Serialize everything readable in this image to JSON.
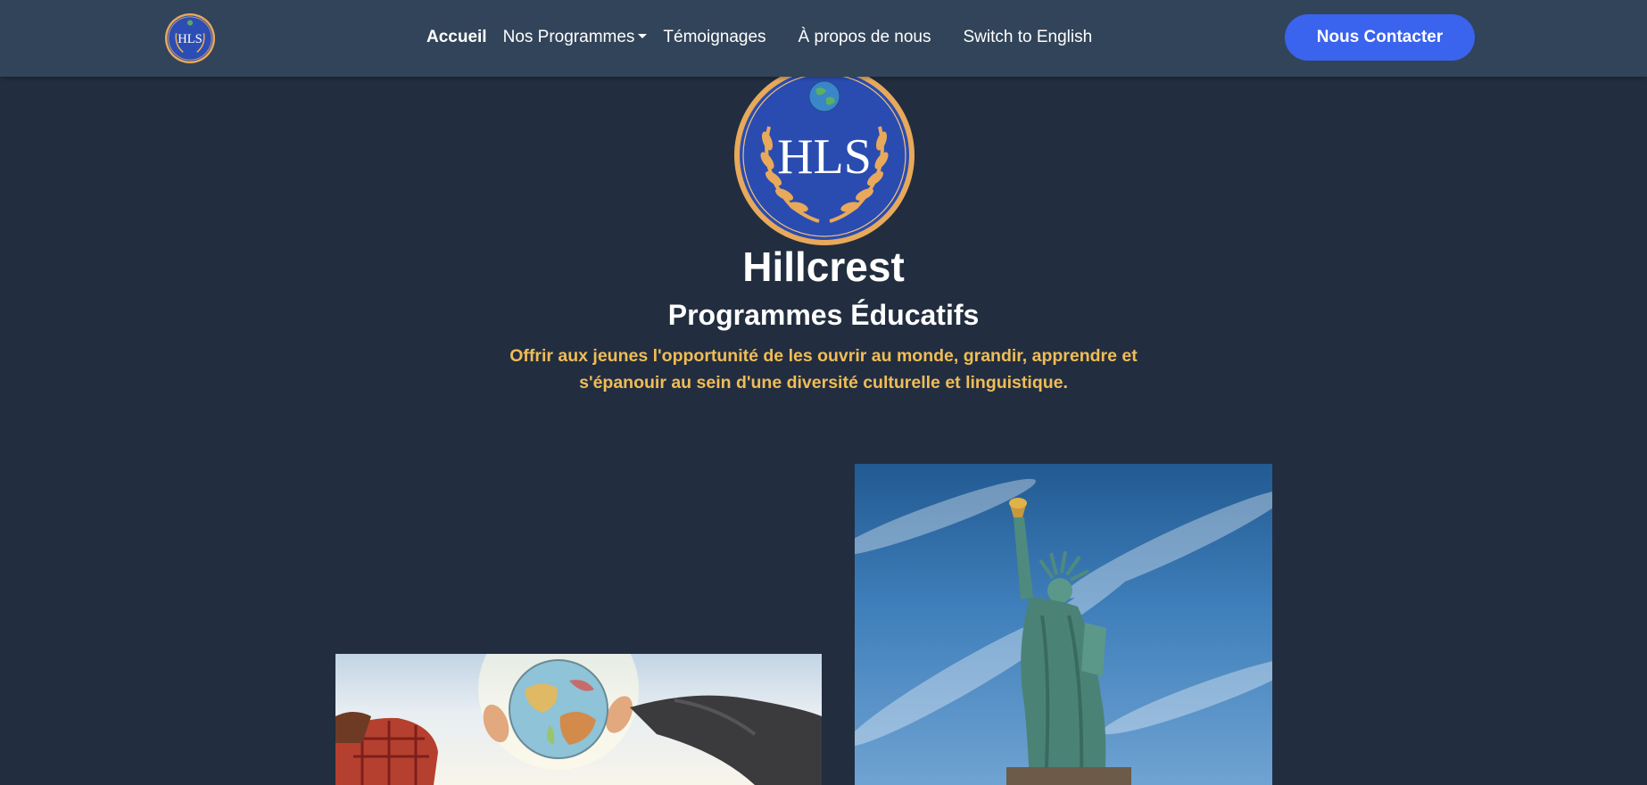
{
  "nav": {
    "logo_text": "HLS",
    "links": [
      {
        "label": "Accueil",
        "active": true
      },
      {
        "label": "Nos Programmes",
        "dropdown": true
      },
      {
        "label": "Témoignages"
      },
      {
        "label": "À propos de nous"
      },
      {
        "label": "Switch to English"
      }
    ],
    "contact_label": "Nous Contacter"
  },
  "hero": {
    "logo_text": "HLS",
    "title": "Hillcrest",
    "subtitle": "Programmes Éducatifs",
    "tagline": "Offrir aux jeunes l'opportunité de les ouvrir au monde, grandir, apprendre et s'épanouir au sein d'une diversité culturelle et linguistique."
  },
  "photos": [
    {
      "name": "globe-photo"
    },
    {
      "name": "statue-of-liberty-photo"
    }
  ],
  "colors": {
    "background": "#222e3f",
    "navbar": "#324459",
    "accent_button": "#3a63ee",
    "tagline": "#f0bc58",
    "logo_blue": "#2c4db3",
    "logo_gold": "#e8a95a"
  }
}
